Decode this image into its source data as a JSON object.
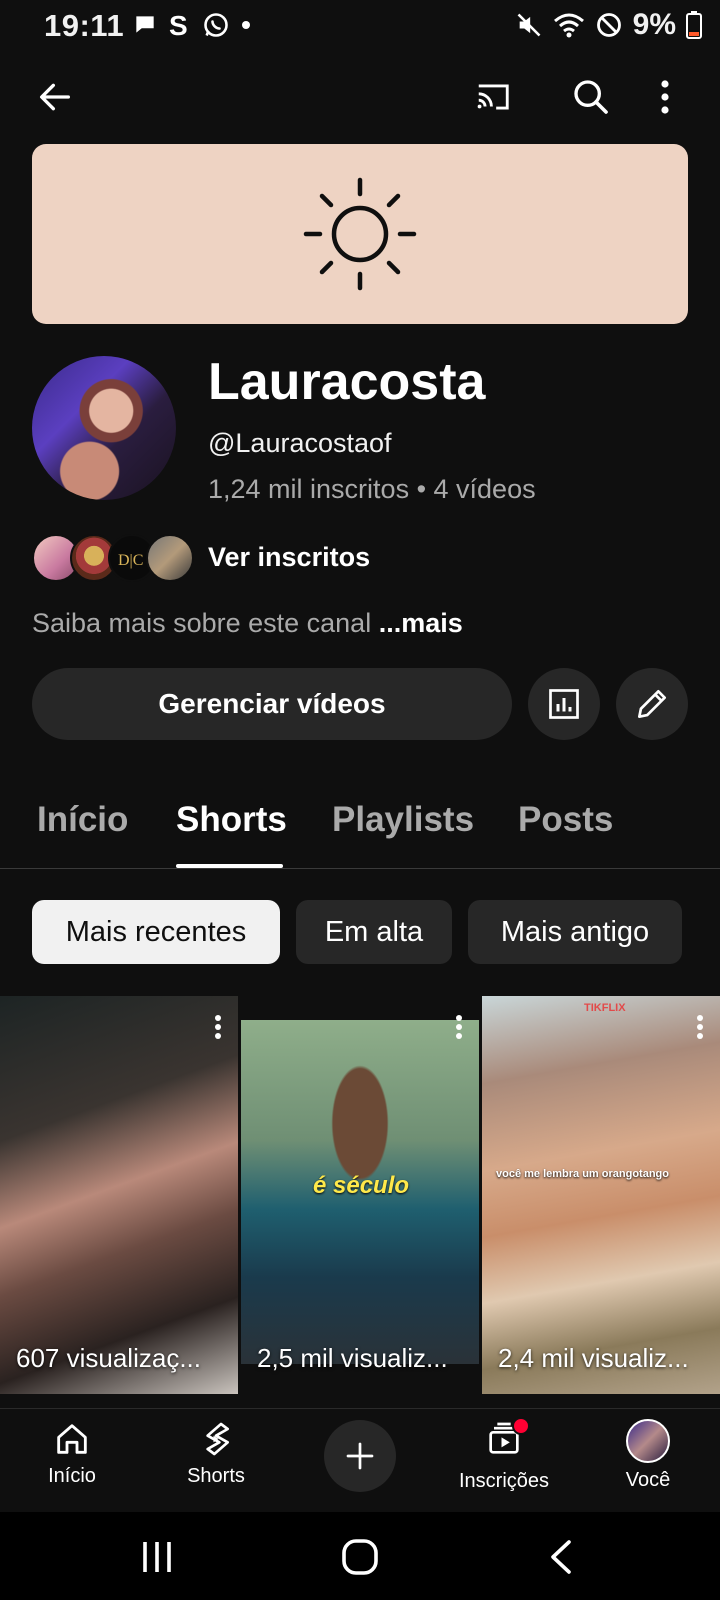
{
  "status_bar": {
    "time": "19:11",
    "battery": "9%",
    "left_icons": [
      "chat-bubble-icon",
      "s-app-icon",
      "whatsapp-icon",
      "dot-icon"
    ],
    "right_icons": [
      "mute-icon",
      "wifi-icon",
      "do-not-disturb-icon",
      "battery-icon"
    ]
  },
  "top_bar": {
    "icons": [
      "back-arrow-icon",
      "cast-icon",
      "search-icon",
      "more-vert-icon"
    ]
  },
  "banner": {
    "icon": "sun-icon",
    "color": "#eed3c3"
  },
  "channel": {
    "name": "Lauracosta",
    "handle": "@Lauracostaof",
    "stats": "1,24 mil inscritos • 4 vídeos",
    "see_subscribers": "Ver inscritos",
    "about": "Saiba mais sobre este canal",
    "about_more": "...mais"
  },
  "actions": {
    "manage_videos": "Gerenciar vídeos",
    "analytics_icon": "analytics-icon",
    "edit_icon": "pencil-icon"
  },
  "tabs": [
    {
      "label": "Início",
      "active": false
    },
    {
      "label": "Shorts",
      "active": true
    },
    {
      "label": "Playlists",
      "active": false
    },
    {
      "label": "Posts",
      "active": false
    }
  ],
  "chips": [
    {
      "label": "Mais recentes",
      "selected": true
    },
    {
      "label": "Em alta",
      "selected": false
    },
    {
      "label": "Mais antigo",
      "selected": false
    }
  ],
  "shorts": [
    {
      "views": "607 visualizaç..."
    },
    {
      "views": "2,5 mil visualiz...",
      "caption": "é século"
    },
    {
      "views": "2,4 mil visualiz...",
      "caption": "você me lembra um orangotango",
      "watermark": "TIKFLIX"
    }
  ],
  "bottom_nav": [
    {
      "label": "Início",
      "icon": "home-icon"
    },
    {
      "label": "Shorts",
      "icon": "shorts-icon"
    },
    {
      "label": "",
      "icon": "plus-icon"
    },
    {
      "label": "Inscrições",
      "icon": "subscriptions-icon",
      "badge": true
    },
    {
      "label": "Você",
      "icon": "avatar-icon"
    }
  ],
  "system_nav": [
    "recents-icon",
    "home-circle-icon",
    "back-chevron-icon"
  ],
  "colors": {
    "background": "#0f0f0f",
    "surface": "#272727",
    "muted_text": "#aaaaaa",
    "badge_red": "#ff0033"
  }
}
